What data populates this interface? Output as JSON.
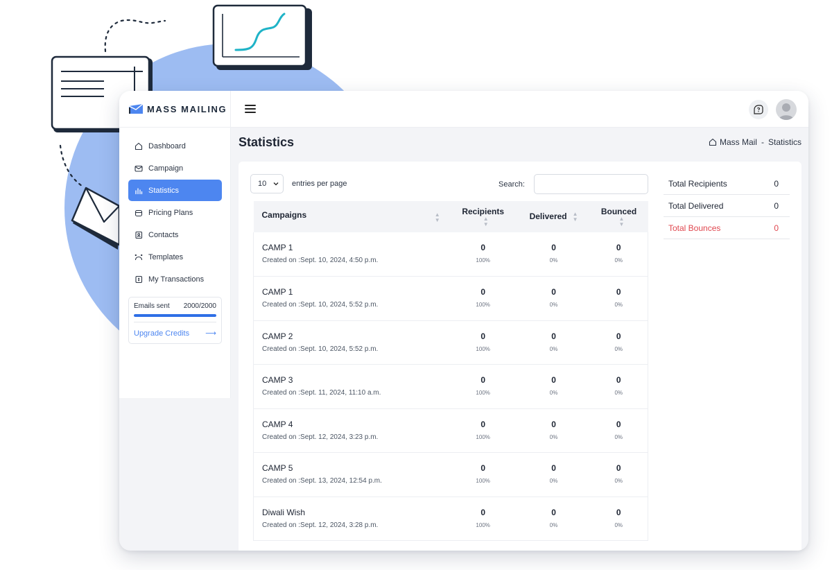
{
  "brand": {
    "name": "MASS MAILING"
  },
  "sidebar": {
    "items": [
      {
        "label": "Dashboard",
        "icon": "home-icon"
      },
      {
        "label": "Campaign",
        "icon": "mail-icon"
      },
      {
        "label": "Statistics",
        "icon": "bar-chart-icon",
        "active": true
      },
      {
        "label": "Pricing Plans",
        "icon": "wallet-icon"
      },
      {
        "label": "Contacts",
        "icon": "contacts-icon"
      },
      {
        "label": "Templates",
        "icon": "template-icon"
      },
      {
        "label": "My Transactions",
        "icon": "transactions-icon"
      }
    ],
    "credits": {
      "label": "Emails sent",
      "value": "2000/2000",
      "progress": 1.0,
      "upgrade_label": "Upgrade Credits",
      "upgrade_arrow": "⟶"
    }
  },
  "header": {
    "help_icon": "help-icon",
    "avatar": "user-avatar"
  },
  "page": {
    "title": "Statistics",
    "breadcrumb": {
      "root": "Mass Mail",
      "sep": "-",
      "current": "Statistics"
    }
  },
  "table_controls": {
    "entries_value": "10",
    "entries_label": "entries per page",
    "search_label": "Search:",
    "search_value": ""
  },
  "table": {
    "columns": [
      "Campaigns",
      "Recipients",
      "Delivered",
      "Bounced"
    ],
    "rows": [
      {
        "name": "CAMP 1",
        "created": "Created on :Sept. 10, 2024, 4:50 p.m.",
        "recipients": "0",
        "recipients_pct": "100%",
        "delivered": "0",
        "delivered_pct": "0%",
        "bounced": "0",
        "bounced_pct": "0%"
      },
      {
        "name": "CAMP 1",
        "created": "Created on :Sept. 10, 2024, 5:52 p.m.",
        "recipients": "0",
        "recipients_pct": "100%",
        "delivered": "0",
        "delivered_pct": "0%",
        "bounced": "0",
        "bounced_pct": "0%"
      },
      {
        "name": "CAMP 2",
        "created": "Created on :Sept. 10, 2024, 5:52 p.m.",
        "recipients": "0",
        "recipients_pct": "100%",
        "delivered": "0",
        "delivered_pct": "0%",
        "bounced": "0",
        "bounced_pct": "0%"
      },
      {
        "name": "CAMP 3",
        "created": "Created on :Sept. 11, 2024, 11:10 a.m.",
        "recipients": "0",
        "recipients_pct": "100%",
        "delivered": "0",
        "delivered_pct": "0%",
        "bounced": "0",
        "bounced_pct": "0%"
      },
      {
        "name": "CAMP 4",
        "created": "Created on :Sept. 12, 2024, 3:23 p.m.",
        "recipients": "0",
        "recipients_pct": "100%",
        "delivered": "0",
        "delivered_pct": "0%",
        "bounced": "0",
        "bounced_pct": "0%"
      },
      {
        "name": "CAMP 5",
        "created": "Created on :Sept. 13, 2024, 12:54 p.m.",
        "recipients": "0",
        "recipients_pct": "100%",
        "delivered": "0",
        "delivered_pct": "0%",
        "bounced": "0",
        "bounced_pct": "0%"
      },
      {
        "name": "Diwali Wish",
        "created": "Created on :Sept. 12, 2024, 3:28 p.m.",
        "recipients": "0",
        "recipients_pct": "100%",
        "delivered": "0",
        "delivered_pct": "0%",
        "bounced": "0",
        "bounced_pct": "0%"
      }
    ]
  },
  "totals": [
    {
      "label": "Total Recipients",
      "value": "0"
    },
    {
      "label": "Total Delivered",
      "value": "0"
    },
    {
      "label": "Total Bounces",
      "value": "0",
      "color": "#e0474f"
    }
  ],
  "colors": {
    "accent": "#4d86f0",
    "bounce": "#e0474f",
    "decor_circle": "#9dbcf2",
    "decor_line": "#1fb3c7"
  }
}
